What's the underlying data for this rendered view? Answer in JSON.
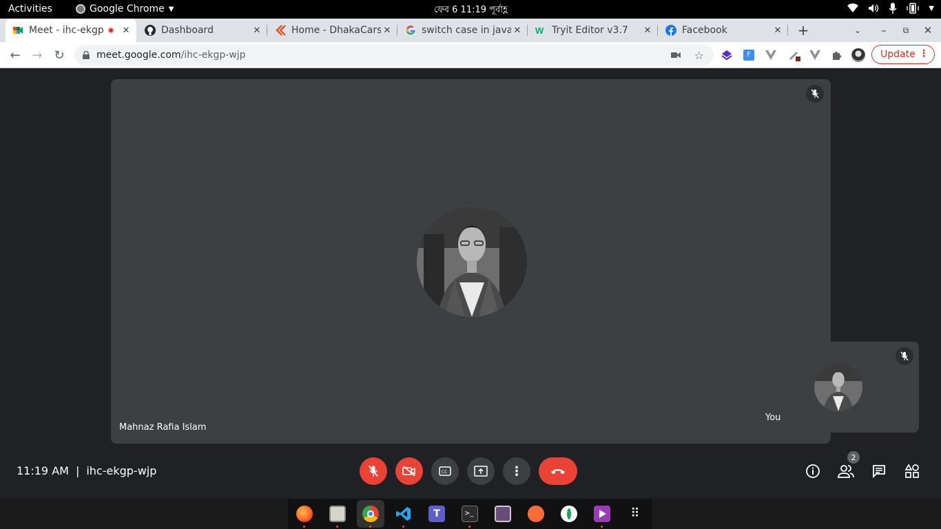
{
  "system": {
    "activities": "Activities",
    "app_name": "Google Chrome",
    "clock": "ফেব 6  11:19 পূর্বাহ্ণ"
  },
  "tabs": [
    {
      "title": "Meet - ihc-ekgp",
      "favicon": "meet-icon",
      "recording": true,
      "active": true
    },
    {
      "title": "Dashboard",
      "favicon": "github-icon"
    },
    {
      "title": "Home - DhakaCars",
      "favicon": "dhakacars-icon"
    },
    {
      "title": "switch case in java",
      "favicon": "google-icon"
    },
    {
      "title": "Tryit Editor v3.7",
      "favicon": "w3schools-icon"
    },
    {
      "title": "Facebook",
      "favicon": "facebook-icon"
    }
  ],
  "address": {
    "host": "meet.google.com",
    "path": "/ihc-ekgp-wjp"
  },
  "toolbar": {
    "update_label": "Update"
  },
  "meeting": {
    "time": "11:19 AM",
    "separator": "|",
    "code": "ihc-ekgp-wjp",
    "main_participant": "Mahnaz Rafia Islam",
    "self_label": "You",
    "participants_count": "2"
  },
  "colors": {
    "meet_bg": "#202124",
    "tile_bg": "#3c4043",
    "danger": "#ea4335",
    "update": "#d93025"
  }
}
